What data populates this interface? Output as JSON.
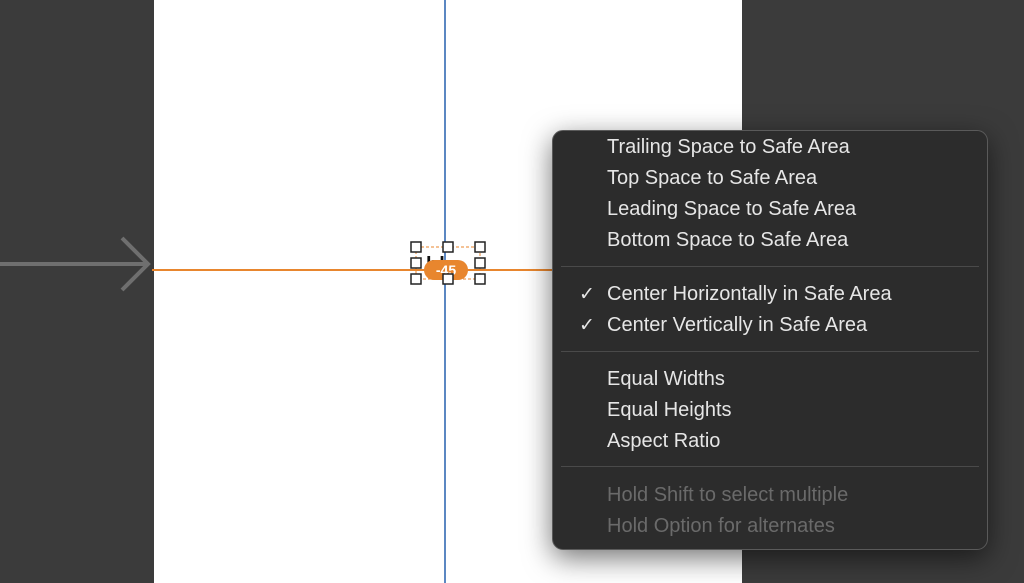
{
  "colors": {
    "workspace_bg": "#3b3b3b",
    "canvas_bg": "#ffffff",
    "vertical_guide": "#5b87c2",
    "horizontal_guide": "#e8862e",
    "badge_bg": "#e8862e",
    "menu_bg": "#2c2c2c",
    "menu_text": "#e6e6e6",
    "menu_text_disabled": "#6a6a6a"
  },
  "canvas": {
    "selected_view_text": "ble",
    "constraint_badge": "-45"
  },
  "menu": {
    "group_edges": [
      {
        "label": "Trailing Space to Safe Area",
        "checked": false
      },
      {
        "label": "Top Space to Safe Area",
        "checked": false
      },
      {
        "label": "Leading Space to Safe Area",
        "checked": false
      },
      {
        "label": "Bottom Space to Safe Area",
        "checked": false
      }
    ],
    "group_center": [
      {
        "label": "Center Horizontally in Safe Area",
        "checked": true,
        "check_glyph": "✓"
      },
      {
        "label": "Center Vertically in Safe Area",
        "checked": true,
        "check_glyph": "✓"
      }
    ],
    "group_size": [
      {
        "label": "Equal Widths"
      },
      {
        "label": "Equal Heights"
      },
      {
        "label": "Aspect Ratio"
      }
    ],
    "hints": [
      {
        "label": "Hold Shift to select multiple"
      },
      {
        "label": "Hold Option for alternates"
      }
    ]
  }
}
